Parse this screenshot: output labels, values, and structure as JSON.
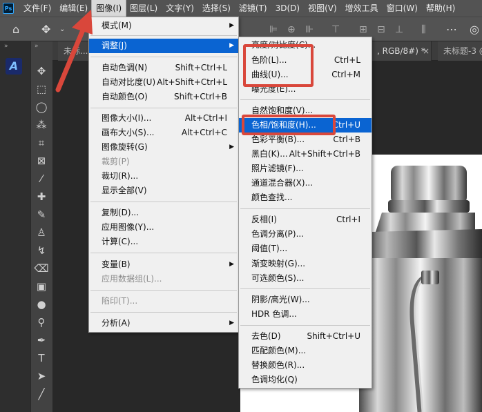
{
  "app": {
    "logo_text": "Ps"
  },
  "menubar": {
    "items": [
      "文件(F)",
      "编辑(E)",
      "图像(I)",
      "图层(L)",
      "文字(Y)",
      "选择(S)",
      "滤镜(T)",
      "3D(D)",
      "视图(V)",
      "增效工具",
      "窗口(W)",
      "帮助(H)"
    ],
    "active_index": 2
  },
  "tabs": [
    {
      "label": "未标..."
    },
    {
      "label": ", RGB/8#) *"
    },
    {
      "label": "×"
    },
    {
      "label": "未标题-3 @"
    }
  ],
  "image_menu": {
    "items": [
      {
        "label": "模式(M)",
        "shortcut": "",
        "submenu": true,
        "disabled": false
      },
      {
        "label": "调整(J)",
        "shortcut": "",
        "submenu": true,
        "disabled": false,
        "highlight": true
      },
      {
        "label": "自动色调(N)",
        "shortcut": "Shift+Ctrl+L"
      },
      {
        "label": "自动对比度(U)",
        "shortcut": "Alt+Shift+Ctrl+L"
      },
      {
        "label": "自动颜色(O)",
        "shortcut": "Shift+Ctrl+B"
      },
      {
        "label": "图像大小(I)...",
        "shortcut": "Alt+Ctrl+I"
      },
      {
        "label": "画布大小(S)...",
        "shortcut": "Alt+Ctrl+C"
      },
      {
        "label": "图像旋转(G)",
        "shortcut": "",
        "submenu": true
      },
      {
        "label": "裁剪(P)",
        "shortcut": "",
        "disabled": true
      },
      {
        "label": "裁切(R)...",
        "shortcut": ""
      },
      {
        "label": "显示全部(V)",
        "shortcut": ""
      },
      {
        "label": "复制(D)...",
        "shortcut": ""
      },
      {
        "label": "应用图像(Y)...",
        "shortcut": ""
      },
      {
        "label": "计算(C)...",
        "shortcut": ""
      },
      {
        "label": "变量(B)",
        "shortcut": "",
        "submenu": true
      },
      {
        "label": "应用数据组(L)...",
        "shortcut": "",
        "disabled": true
      },
      {
        "label": "陷印(T)...",
        "shortcut": "",
        "disabled": true
      },
      {
        "label": "分析(A)",
        "shortcut": "",
        "submenu": true
      }
    ]
  },
  "adjust_menu": {
    "items": [
      {
        "label": "亮度/对比度(C)...",
        "shortcut": ""
      },
      {
        "label": "色阶(L)...",
        "shortcut": "Ctrl+L"
      },
      {
        "label": "曲线(U)...",
        "shortcut": "Ctrl+M"
      },
      {
        "label": "曝光度(E)...",
        "shortcut": ""
      },
      {
        "label": "自然饱和度(V)...",
        "shortcut": ""
      },
      {
        "label": "色相/饱和度(H)...",
        "shortcut": "Ctrl+U",
        "highlight": true
      },
      {
        "label": "色彩平衡(B)...",
        "shortcut": "Ctrl+B"
      },
      {
        "label": "黑白(K)...",
        "shortcut": "Alt+Shift+Ctrl+B"
      },
      {
        "label": "照片滤镜(F)...",
        "shortcut": ""
      },
      {
        "label": "通道混合器(X)...",
        "shortcut": ""
      },
      {
        "label": "颜色查找...",
        "shortcut": ""
      },
      {
        "label": "反相(I)",
        "shortcut": "Ctrl+I"
      },
      {
        "label": "色调分离(P)...",
        "shortcut": ""
      },
      {
        "label": "阈值(T)...",
        "shortcut": ""
      },
      {
        "label": "渐变映射(G)...",
        "shortcut": ""
      },
      {
        "label": "可选颜色(S)...",
        "shortcut": ""
      },
      {
        "label": "阴影/高光(W)...",
        "shortcut": ""
      },
      {
        "label": "HDR 色调...",
        "shortcut": ""
      },
      {
        "label": "去色(D)",
        "shortcut": "Shift+Ctrl+U"
      },
      {
        "label": "匹配颜色(M)...",
        "shortcut": ""
      },
      {
        "label": "替换颜色(R)...",
        "shortcut": ""
      },
      {
        "label": "色调均化(Q)",
        "shortcut": ""
      }
    ]
  },
  "colors": {
    "highlight": "#0a64d2",
    "annotation_red": "#d9473b"
  }
}
